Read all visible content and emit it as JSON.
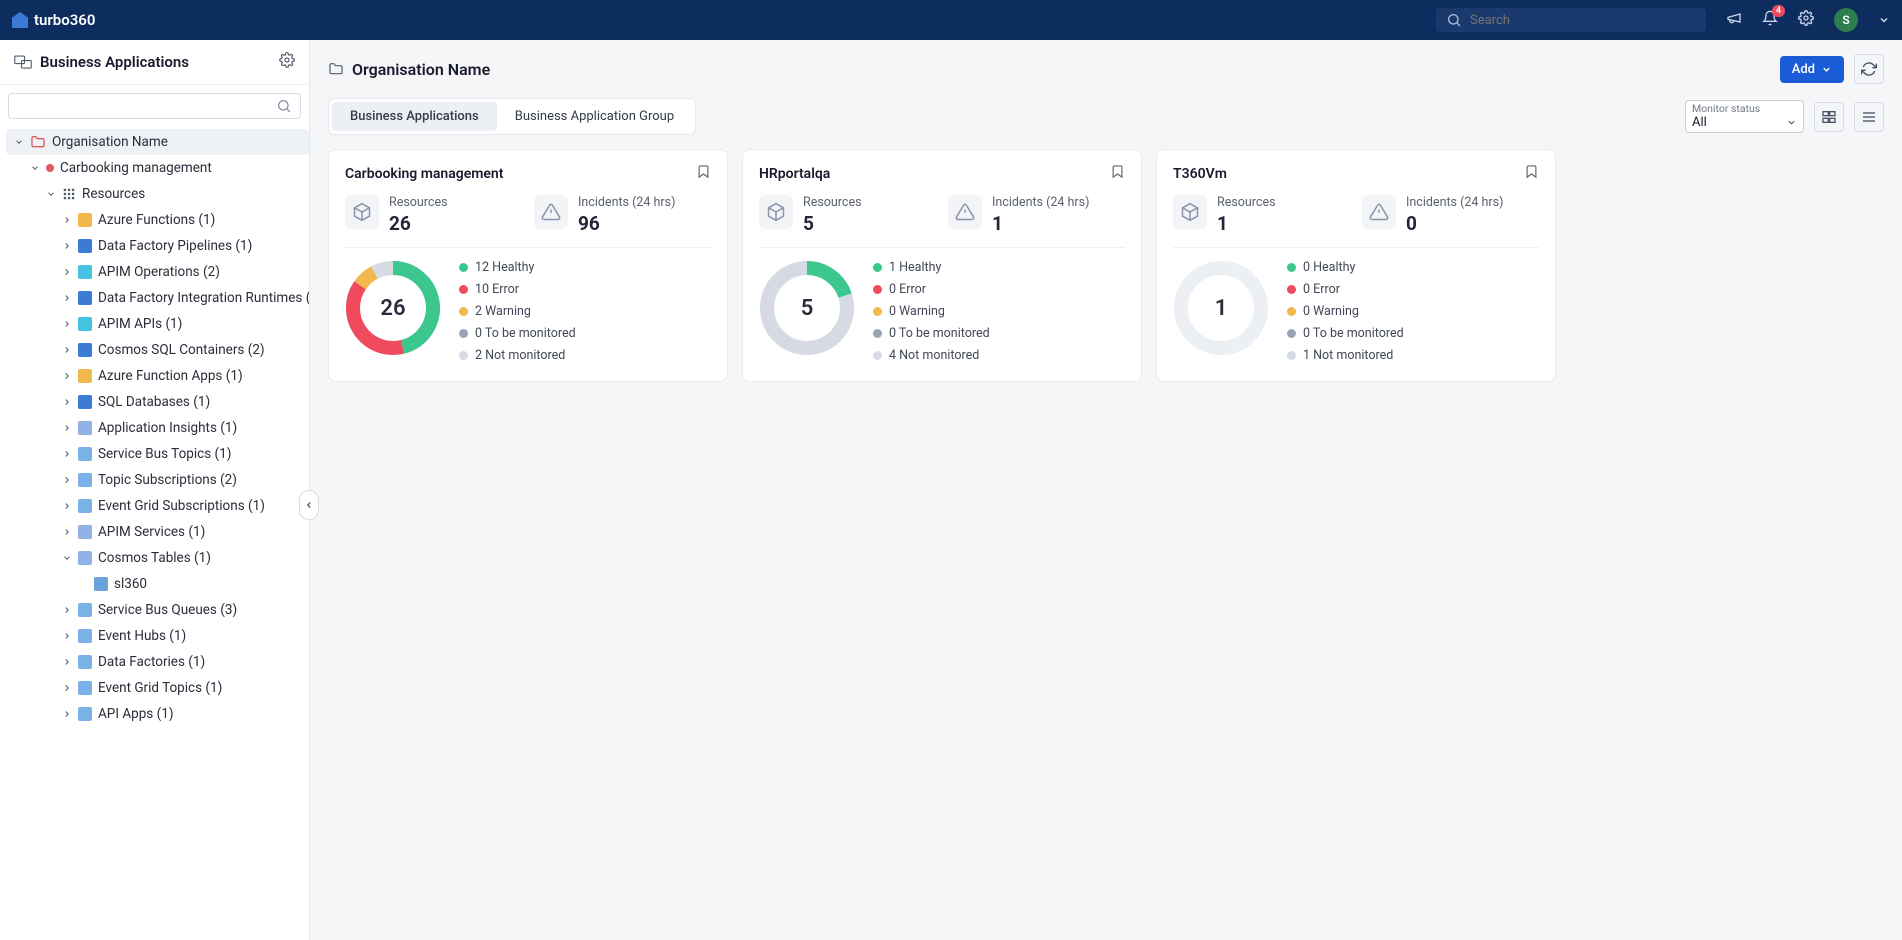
{
  "brand": "turbo360",
  "search": {
    "placeholder": "Search"
  },
  "notifications_badge": "4",
  "avatar_initial": "S",
  "sidebar": {
    "title": "Business Applications",
    "root": "Organisation Name",
    "carbooking": "Carbooking management",
    "resources_label": "Resources",
    "nodes": [
      "Azure Functions (1)",
      "Data Factory Pipelines (1)",
      "APIM Operations (2)",
      "Data Factory Integration Runtimes (…",
      "APIM APIs (1)",
      "Cosmos SQL Containers (2)",
      "Azure Function Apps (1)",
      "SQL Databases (1)",
      "Application Insights (1)",
      "Service Bus Topics (1)",
      "Topic Subscriptions (2)",
      "Event Grid Subscriptions (1)",
      "APIM Services (1)",
      "Cosmos Tables (1)"
    ],
    "child_leaf": "sl360",
    "tail_nodes": [
      "Service Bus Queues (3)",
      "Event Hubs (1)",
      "Data Factories (1)",
      "Event Grid Topics (1)",
      "API Apps (1)"
    ]
  },
  "main": {
    "title": "Organisation Name",
    "add_label": "Add",
    "tabs": [
      "Business Applications",
      "Business Application Group"
    ],
    "filter_label": "Monitor status",
    "filter_value": "All"
  },
  "legend_labels": {
    "healthy": "Healthy",
    "error": "Error",
    "warning": "Warning",
    "tbm": "To be monitored",
    "nm": "Not monitored"
  },
  "stat_labels": {
    "resources": "Resources",
    "incidents": "Incidents (24 hrs)"
  },
  "cards": [
    {
      "title": "Carbooking management",
      "resources": "26",
      "incidents": "96",
      "center": "26",
      "legend": {
        "healthy": "12",
        "error": "10",
        "warning": "2",
        "tbm": "0",
        "nm": "2"
      }
    },
    {
      "title": "HRportalqa",
      "resources": "5",
      "incidents": "1",
      "center": "5",
      "legend": {
        "healthy": "1",
        "error": "0",
        "warning": "0",
        "tbm": "0",
        "nm": "4"
      }
    },
    {
      "title": "T360Vm",
      "resources": "1",
      "incidents": "0",
      "center": "1",
      "legend": {
        "healthy": "0",
        "error": "0",
        "warning": "0",
        "tbm": "0",
        "nm": "1"
      }
    }
  ],
  "chart_data": [
    {
      "type": "pie",
      "title": "Carbooking management",
      "categories": [
        "Healthy",
        "Error",
        "Warning",
        "To be monitored",
        "Not monitored"
      ],
      "values": [
        12,
        10,
        2,
        0,
        2
      ]
    },
    {
      "type": "pie",
      "title": "HRportalqa",
      "categories": [
        "Healthy",
        "Error",
        "Warning",
        "To be monitored",
        "Not monitored"
      ],
      "values": [
        1,
        0,
        0,
        0,
        4
      ]
    },
    {
      "type": "pie",
      "title": "T360Vm",
      "categories": [
        "Healthy",
        "Error",
        "Warning",
        "To be monitored",
        "Not monitored"
      ],
      "values": [
        0,
        0,
        0,
        0,
        1
      ]
    }
  ],
  "colors": {
    "healthy": "#3cc78f",
    "error": "#f04a5e",
    "warning": "#f2b84b",
    "tbm": "#9aa3b5",
    "nm": "#d6dae3"
  }
}
